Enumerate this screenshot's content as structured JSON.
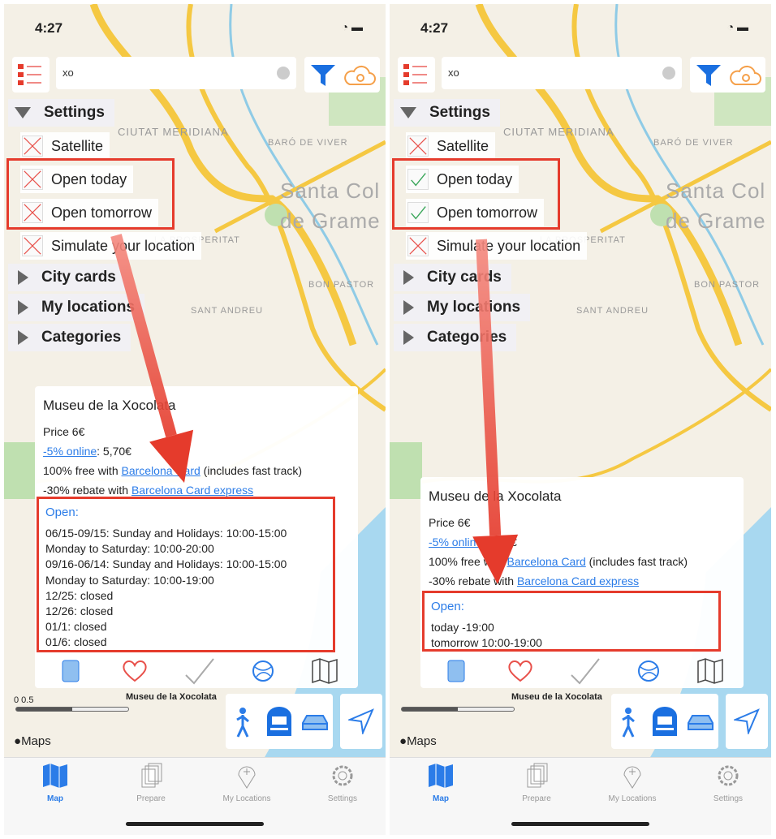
{
  "colors": {
    "accent": "#2b7ce8",
    "highlight": "#e53b2c",
    "unchecked": "#e8504a",
    "checked": "#3aa65a"
  },
  "screens": [
    {
      "status": {
        "time": "4:27"
      },
      "search": {
        "value": "xo"
      },
      "menu": {
        "settings": "Settings",
        "options": [
          {
            "label": "Satellite",
            "checked": false
          },
          {
            "label": "Open today",
            "checked": false
          },
          {
            "label": "Open tomorrow",
            "checked": false
          },
          {
            "label": "Simulate your location",
            "checked": false
          }
        ],
        "sections": [
          "City cards",
          "My locations",
          "Categories"
        ]
      },
      "popup": {
        "title": "Museu de la Xocolata",
        "price": "Price 6€",
        "online_link": "-5% online",
        "online_price": ": 5,70€",
        "free_prefix": "100% free with ",
        "free_link": "Barcelona Card",
        "free_suffix": " (includes fast track)",
        "rebate_prefix": "-30% rebate with ",
        "rebate_link": "Barcelona Card express",
        "open_label": "Open:",
        "open_lines": [
          "06/15-09/15: Sunday and Holidays: 10:00-15:00",
          "Monday to Saturday: 10:00-20:00",
          "09/16-06/14: Sunday and Holidays: 10:00-15:00",
          "Monday to Saturday: 10:00-19:00",
          "12/25: closed",
          "12/26: closed",
          "01/1: closed",
          "01/6: closed"
        ]
      },
      "map": {
        "pin_label": "Museu de la Xocolata",
        "scale": "0       0.5",
        "maps_logo": "Maps",
        "labels": [
          "CIUTAT MERIDIANA",
          "Santa Col",
          "de Grame",
          "BARÓ DE VIVER",
          "LA PROSPERITAT",
          "BON PASTOR",
          "SANT ANDREU"
        ]
      },
      "tabs": [
        {
          "label": "Map",
          "active": true
        },
        {
          "label": "Prepare"
        },
        {
          "label": "My Locations"
        },
        {
          "label": "Settings"
        }
      ]
    },
    {
      "status": {
        "time": "4:27"
      },
      "search": {
        "value": "xo"
      },
      "menu": {
        "settings": "Settings",
        "options": [
          {
            "label": "Satellite",
            "checked": false
          },
          {
            "label": "Open today",
            "checked": true
          },
          {
            "label": "Open tomorrow",
            "checked": true
          },
          {
            "label": "Simulate your location",
            "checked": false
          }
        ],
        "sections": [
          "City cards",
          "My locations",
          "Categories"
        ]
      },
      "popup": {
        "title": "Museu de la Xocolata",
        "price": "Price 6€",
        "online_link": "-5% online",
        "online_price": ": 5,70€",
        "free_prefix": "100% free with ",
        "free_link": "Barcelona Card",
        "free_suffix": " (includes fast track)",
        "rebate_prefix": "-30% rebate with ",
        "rebate_link": "Barcelona Card express",
        "open_label": "Open:",
        "open_lines": [
          "today -19:00",
          "tomorrow 10:00-19:00"
        ]
      },
      "map": {
        "pin_label": "Museu de la Xocolata",
        "scale": "",
        "maps_logo": "Maps",
        "labels": [
          "CIUTAT MERIDIANA",
          "Santa Col",
          "de Grame",
          "BARÓ DE VIVER",
          "LA PROSPERITAT",
          "BON PASTOR",
          "SANT ANDREU"
        ]
      },
      "tabs": [
        {
          "label": "Map",
          "active": true
        },
        {
          "label": "Prepare"
        },
        {
          "label": "My Locations"
        },
        {
          "label": "Settings"
        }
      ]
    }
  ]
}
